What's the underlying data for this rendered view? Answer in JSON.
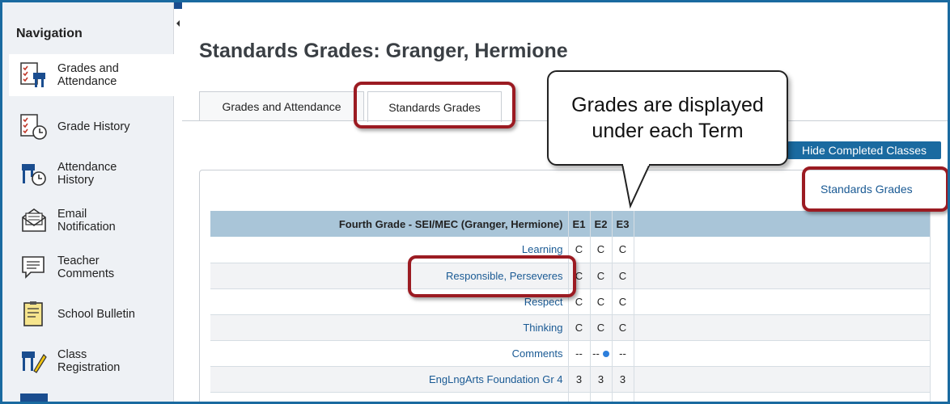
{
  "sidebar": {
    "title": "Navigation",
    "items": [
      {
        "label": "Grades and Attendance",
        "icon": "grades-attendance-icon"
      },
      {
        "label": "Grade History",
        "icon": "grade-history-icon"
      },
      {
        "label": "Attendance History",
        "icon": "attendance-history-icon"
      },
      {
        "label": "Email Notification",
        "icon": "email-icon"
      },
      {
        "label": "Teacher Comments",
        "icon": "comments-icon"
      },
      {
        "label": "School Bulletin",
        "icon": "bulletin-icon"
      },
      {
        "label": "Class Registration",
        "icon": "class-registration-icon"
      }
    ]
  },
  "main": {
    "title": "Standards Grades: Granger, Hermione",
    "tabs": [
      {
        "label": "Grades and Attendance"
      },
      {
        "label": "Standards Grades"
      }
    ],
    "hide_button": "Hide Completed Classes",
    "standards_link": "Standards Grades",
    "table": {
      "header": [
        "Fourth Grade - SEI/MEC (Granger, Hermione)",
        "E1",
        "E2",
        "E3"
      ],
      "rows": [
        {
          "name": "Learning",
          "e1": "C",
          "e2": "C",
          "e3": "C"
        },
        {
          "name": "Responsible, Perseveres",
          "e1": "C",
          "e2": "C",
          "e3": "C"
        },
        {
          "name": "Respect",
          "e1": "C",
          "e2": "C",
          "e3": "C"
        },
        {
          "name": "Thinking",
          "e1": "C",
          "e2": "C",
          "e3": "C"
        },
        {
          "name": "Comments",
          "e1": "--",
          "e2": "--",
          "e3": "--"
        },
        {
          "name": "EngLngArts Foundation Gr 4",
          "e1": "3",
          "e2": "3",
          "e3": "3"
        },
        {
          "name": "",
          "e1": "",
          "e2": "",
          "e3": ""
        }
      ]
    }
  },
  "callout": {
    "text": "Grades are displayed under each Term"
  },
  "colors": {
    "accent": "#1a6aa0",
    "highlight": "#9b1b22",
    "header": "#a9c5d8"
  }
}
